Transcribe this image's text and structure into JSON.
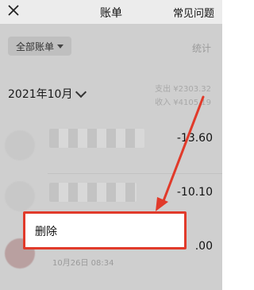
{
  "nav": {
    "title": "账单",
    "help_label": "常见问题",
    "close_icon": "close-icon"
  },
  "filter": {
    "label": "全部账单",
    "stats_label": "统计"
  },
  "month": {
    "label": "2021年10月",
    "expense": "支出 ¥2303.32",
    "income": "收入 ¥4105.19"
  },
  "transactions": [
    {
      "amount": "-13.60"
    },
    {
      "amount": "-10.10"
    },
    {
      "amount_partial": ".00",
      "time": "10月26日 08:34"
    }
  ],
  "ghost_subtitle": "…………",
  "context_menu": {
    "delete_label": "删除"
  },
  "colors": {
    "overlay": "#cfcfcf",
    "highlight": "#e13a2a",
    "menu_bg": "#ffffff"
  }
}
